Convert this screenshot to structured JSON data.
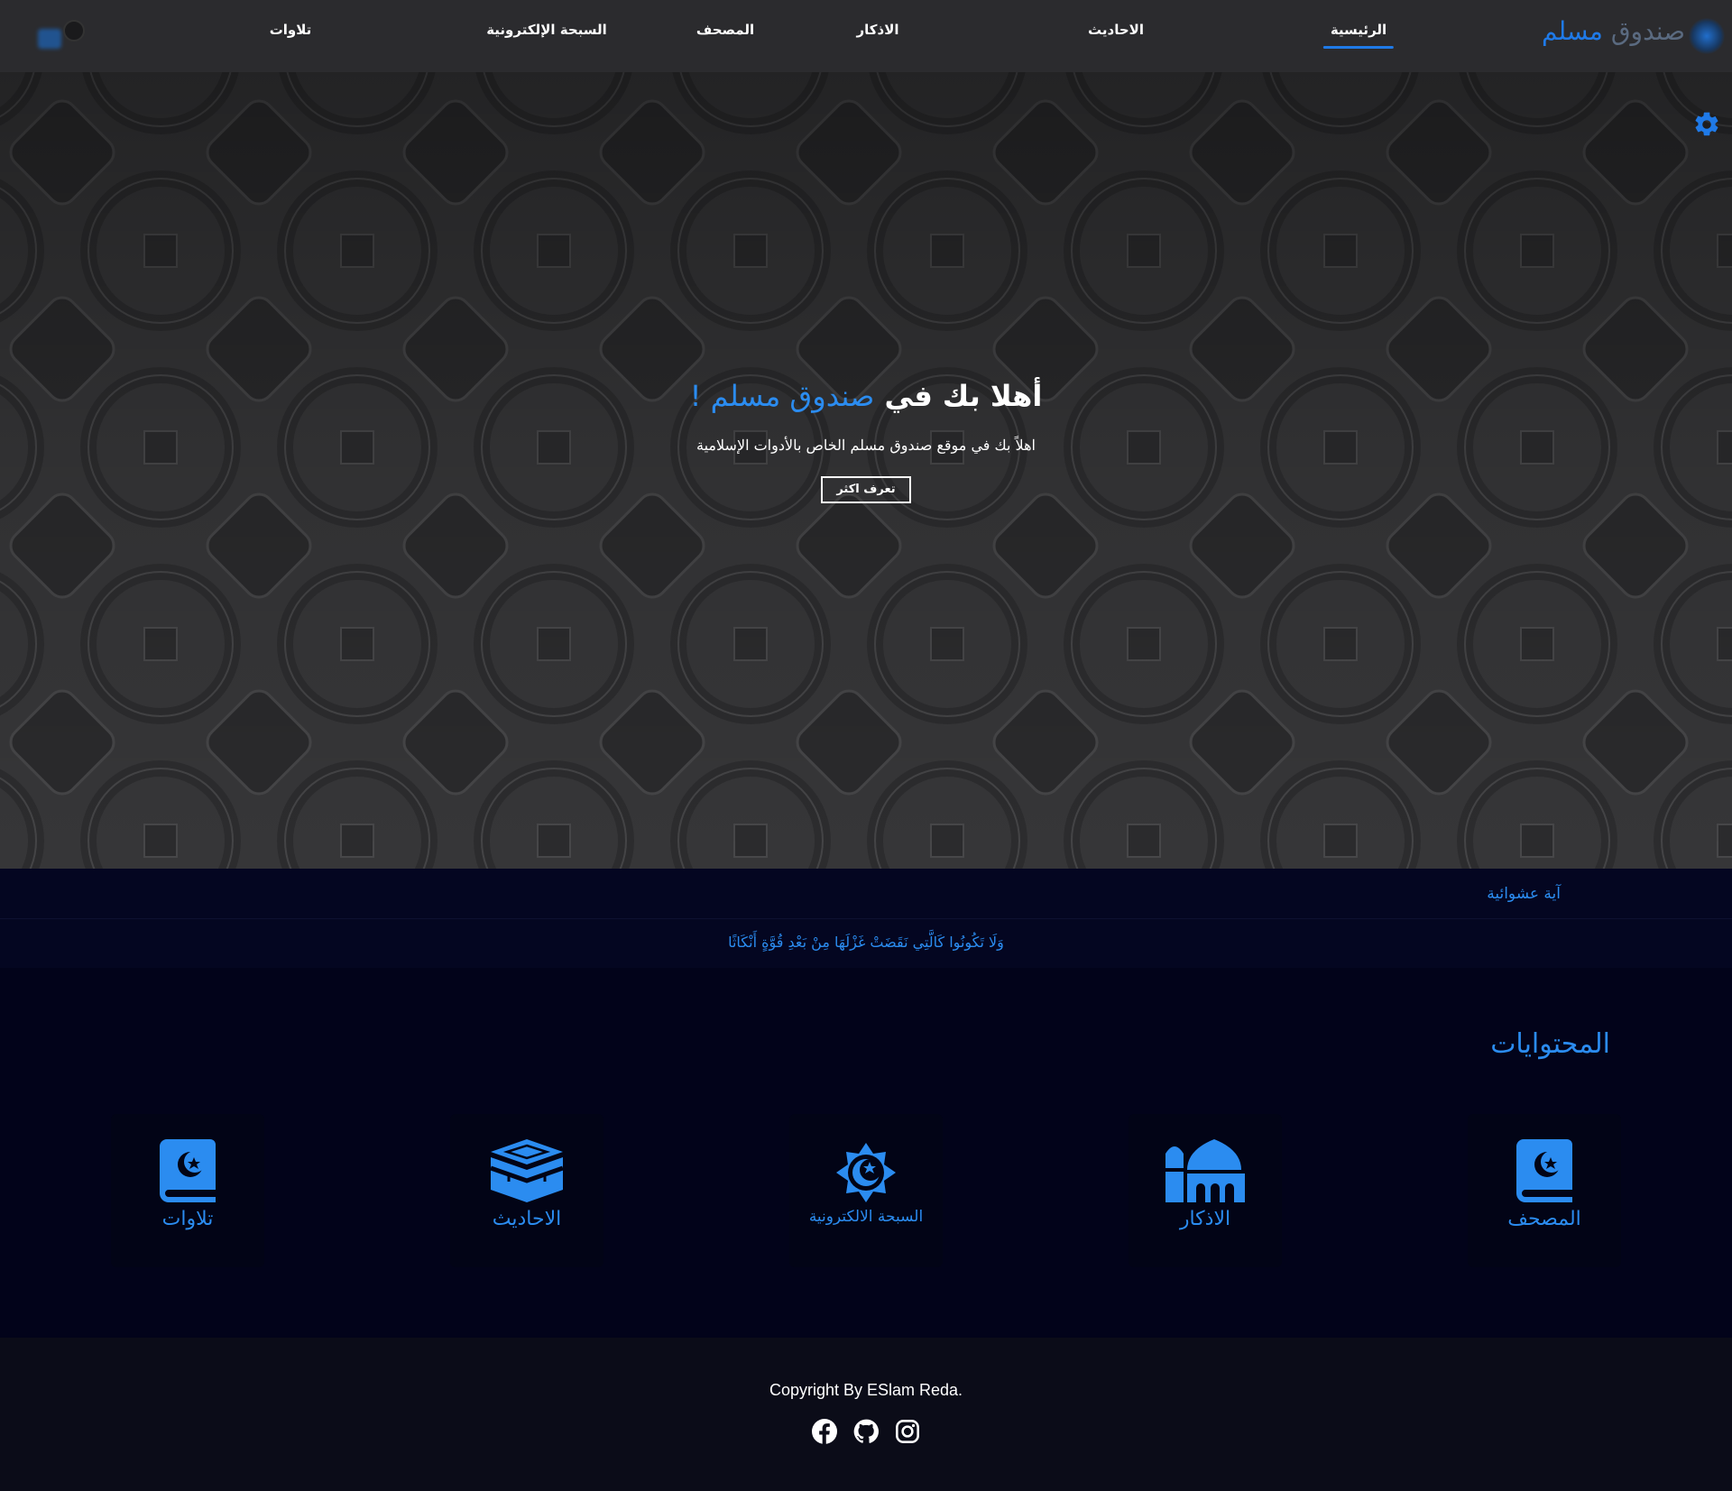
{
  "brand": {
    "logo_part1": "صندوق",
    "logo_part2": "مسلم",
    "accent_color": "#1f7ae8"
  },
  "nav": {
    "items": [
      {
        "label": "الرئيسية",
        "active": true
      },
      {
        "label": "الاحاديث",
        "active": false
      },
      {
        "label": "الاذكار",
        "active": false
      },
      {
        "label": "المصحف",
        "active": false
      },
      {
        "label": "السبحة الإلكترونية",
        "active": false
      },
      {
        "label": "تلاوات",
        "active": false
      }
    ]
  },
  "hero": {
    "title_prefix": "أهلا بك في",
    "title_highlight": "صندوق مسلم !",
    "subtitle": "اهلاً بك في موقع صندوق مسلم الخاص بالأدوات الإسلامية",
    "button_label": "تعرف اكثر"
  },
  "ayah": {
    "label": "آية عشوائية",
    "text": "وَلَا تَكُونُوا كَالَّتِي نَقَضَتْ غَزْلَهَا مِنْ بَعْدِ قُوَّةٍ أَنْكَاثًا"
  },
  "contents": {
    "title": "المحتوايات",
    "cards": [
      {
        "label": "المصحف",
        "icon": "quran-book-icon"
      },
      {
        "label": "الاذكار",
        "icon": "mosque-icon"
      },
      {
        "label": "السبحة الالكترونية",
        "icon": "star-crescent-icon"
      },
      {
        "label": "الاحاديث",
        "icon": "kaaba-icon"
      },
      {
        "label": "تلاوات",
        "icon": "quran-book-icon"
      }
    ]
  },
  "footer": {
    "copyright": "Copyright By ESlam Reda.",
    "socials": [
      "facebook-icon",
      "github-icon",
      "instagram-icon"
    ]
  }
}
